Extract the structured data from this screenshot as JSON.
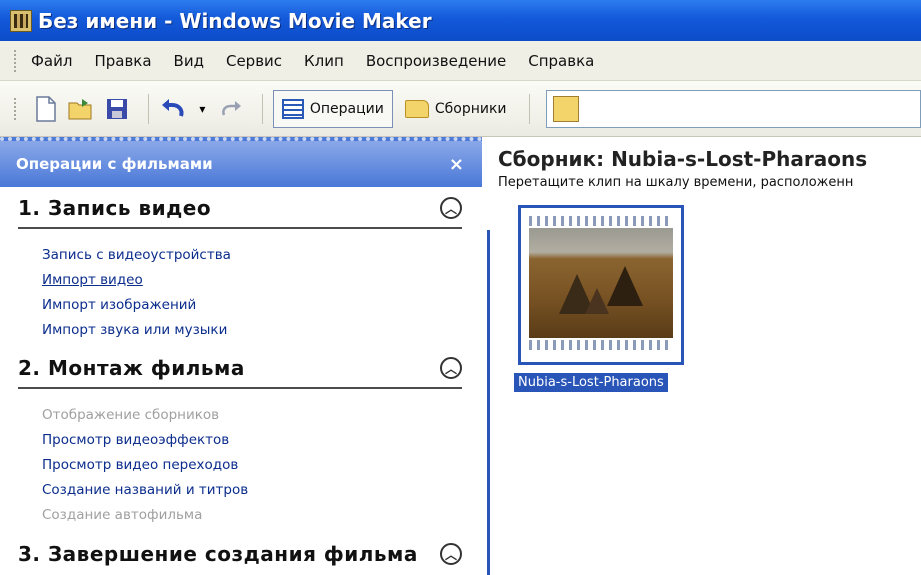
{
  "window": {
    "title": "Без имени - Windows Movie Maker"
  },
  "menu": {
    "items": [
      "Файл",
      "Правка",
      "Вид",
      "Сервис",
      "Клип",
      "Воспроизведение",
      "Справка"
    ]
  },
  "toolbar": {
    "operations_label": "Операции",
    "collections_label": "Сборники",
    "undo_arrow": "▾"
  },
  "task_pane": {
    "header": "Операции с фильмами",
    "close": "×",
    "sections": [
      {
        "title": "1. Запись видео",
        "links": [
          {
            "label": "Запись с видеоустройства",
            "state": "normal"
          },
          {
            "label": "Импорт видео",
            "state": "hover"
          },
          {
            "label": "Импорт изображений",
            "state": "normal"
          },
          {
            "label": "Импорт звука или музыки",
            "state": "normal"
          }
        ]
      },
      {
        "title": "2. Монтаж фильма",
        "links": [
          {
            "label": "Отображение сборников",
            "state": "disabled"
          },
          {
            "label": "Просмотр видеоэффектов",
            "state": "normal"
          },
          {
            "label": "Просмотр видео переходов",
            "state": "normal"
          },
          {
            "label": "Создание названий и титров",
            "state": "normal"
          },
          {
            "label": "Создание автофильма",
            "state": "disabled"
          }
        ]
      },
      {
        "title": "3. Завершение создания фильма",
        "links": []
      }
    ]
  },
  "collection": {
    "title": "Сборник: Nubia-s-Lost-Pharaons",
    "subtitle": "Перетащите клип на шкалу времени, расположенн",
    "clip_name": "Nubia-s-Lost-Pharaons"
  },
  "colors": {
    "titlebar": "#1359d9",
    "pane_header": "#4a78d8",
    "link": "#0b2d8c",
    "selection": "#2a55b8"
  }
}
